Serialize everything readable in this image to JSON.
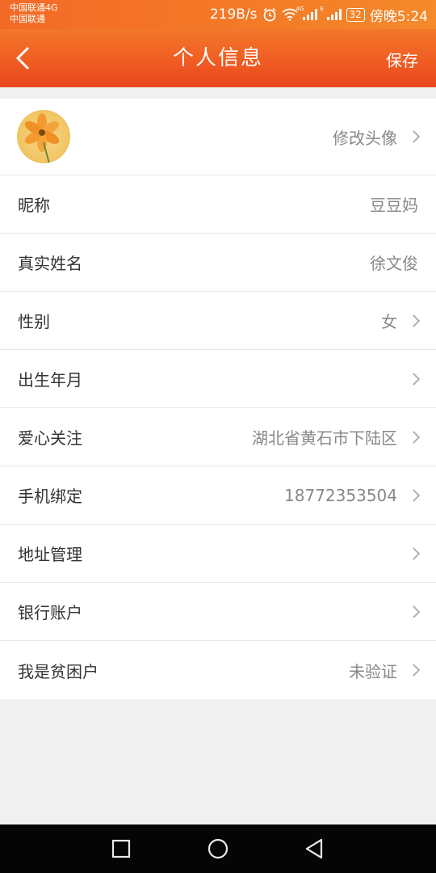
{
  "status_bar": {
    "carrier_1": "中国联通4G",
    "carrier_2": "中国联通",
    "speed": "219B/s",
    "battery": "32",
    "time": "傍晚5:24",
    "icons": [
      "alarm-icon",
      "wifi-icon",
      "signal-4g-icon",
      "signal-e-icon",
      "battery-icon"
    ]
  },
  "header": {
    "title": "个人信息",
    "save_label": "保存",
    "back_icon": "back-arrow-icon",
    "color": "#f05a22"
  },
  "avatar_row": {
    "label": "修改头像",
    "avatar_icon": "flower-avatar"
  },
  "rows": [
    {
      "label": "昵称",
      "value": "豆豆妈",
      "arrow": false
    },
    {
      "label": "真实姓名",
      "value": "徐文俊",
      "arrow": false
    },
    {
      "label": "性别",
      "value": "女",
      "arrow": true
    },
    {
      "label": "出生年月",
      "value": "",
      "arrow": true
    },
    {
      "label": "爱心关注",
      "value": "湖北省黄石市下陆区",
      "arrow": true
    },
    {
      "label": "手机绑定",
      "value": "18772353504",
      "arrow": true
    },
    {
      "label": "地址管理",
      "value": "",
      "arrow": true
    },
    {
      "label": "银行账户",
      "value": "",
      "arrow": true
    },
    {
      "label": "我是贫困户",
      "value": "未验证",
      "arrow": true
    }
  ],
  "nav_bar": {
    "icons": [
      "recent-apps-icon",
      "home-icon",
      "back-icon"
    ]
  }
}
